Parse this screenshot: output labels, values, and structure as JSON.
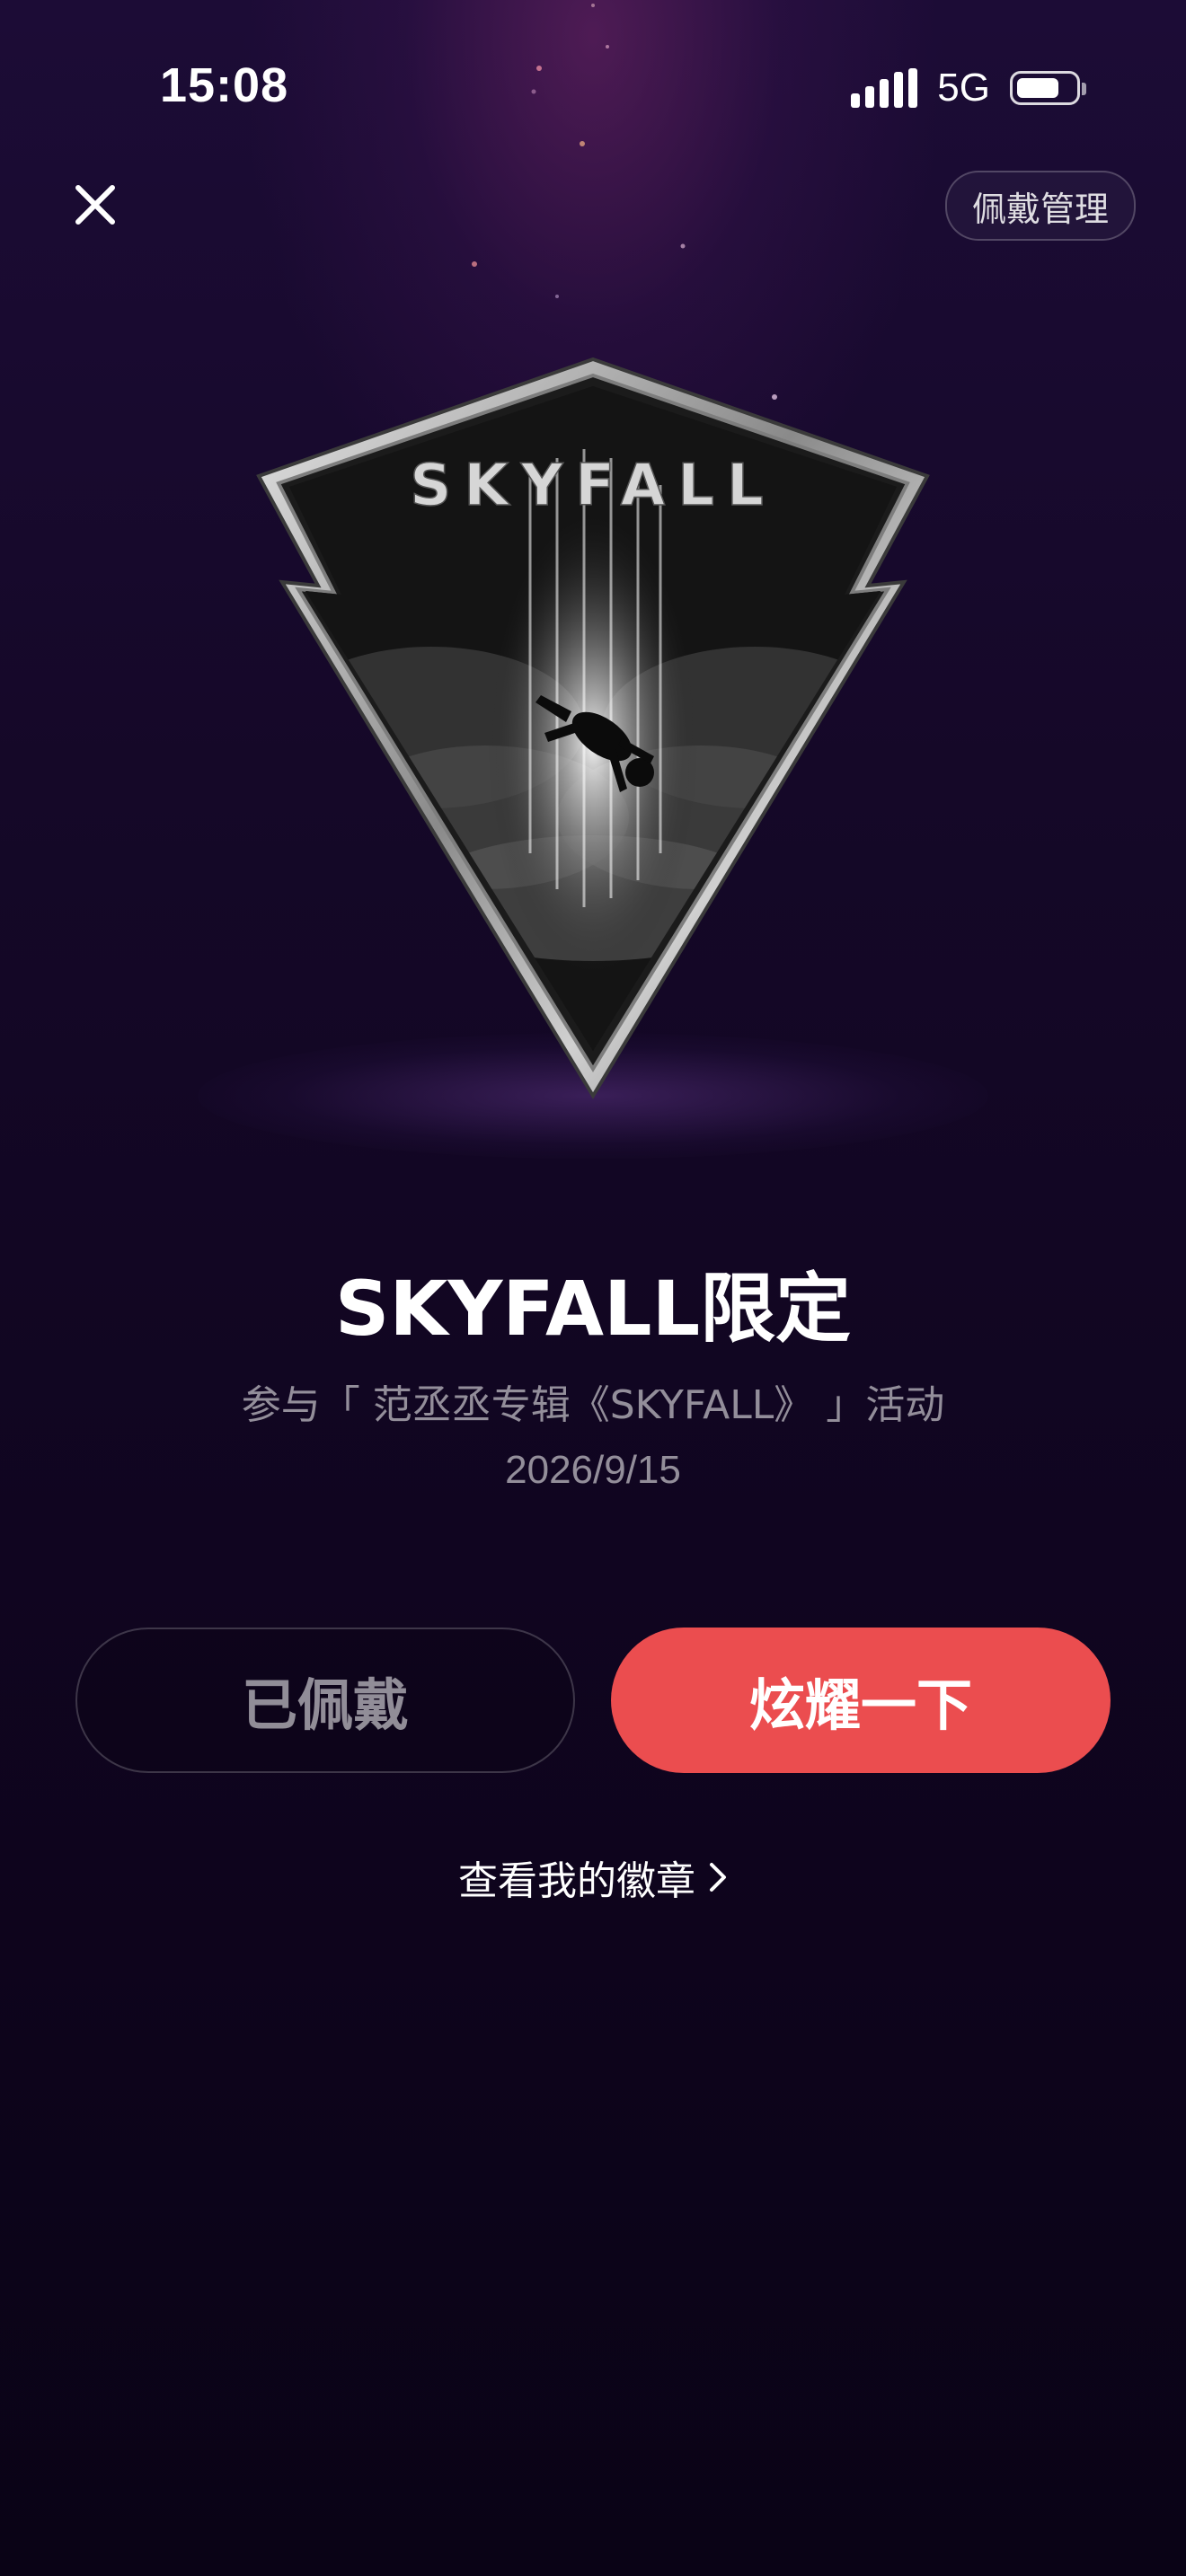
{
  "status_bar": {
    "time": "15:08",
    "network": "5G",
    "battery_level": 0.7
  },
  "header": {
    "close_icon": "close-icon",
    "manage_label": "佩戴管理"
  },
  "badge": {
    "name": "SKYFALL"
  },
  "title": "SKYFALL限定",
  "subtitle": "参与「 范丞丞专辑《SKYFALL》 」活动",
  "date": "2026/9/15",
  "buttons": {
    "worn_label": "已佩戴",
    "show_label": "炫耀一下"
  },
  "link": {
    "label": "查看我的徽章",
    "chevron_icon": "chevron-right-icon"
  },
  "colors": {
    "accent": "#eb4d4f",
    "background": "#140726"
  }
}
